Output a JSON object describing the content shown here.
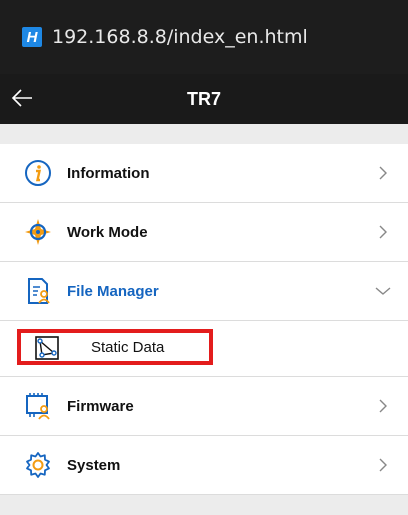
{
  "browser": {
    "site_icon_letter": "H",
    "url": "192.168.8.8/index_en.html"
  },
  "app": {
    "title": "TR7"
  },
  "menu": {
    "items": [
      {
        "label": "Information",
        "icon": "info-icon",
        "expanded": false
      },
      {
        "label": "Work Mode",
        "icon": "compass-icon",
        "expanded": false
      },
      {
        "label": "File Manager",
        "icon": "file-manager-icon",
        "expanded": true,
        "subitems": [
          {
            "label": "Static Data",
            "icon": "static-data-icon",
            "highlighted": true
          }
        ]
      },
      {
        "label": "Firmware",
        "icon": "firmware-icon",
        "expanded": false
      },
      {
        "label": "System",
        "icon": "gear-icon",
        "expanded": false
      }
    ]
  },
  "colors": {
    "accent": "#1565c0",
    "highlight_border": "#e31c1c",
    "icon_orange": "#f39c12"
  }
}
